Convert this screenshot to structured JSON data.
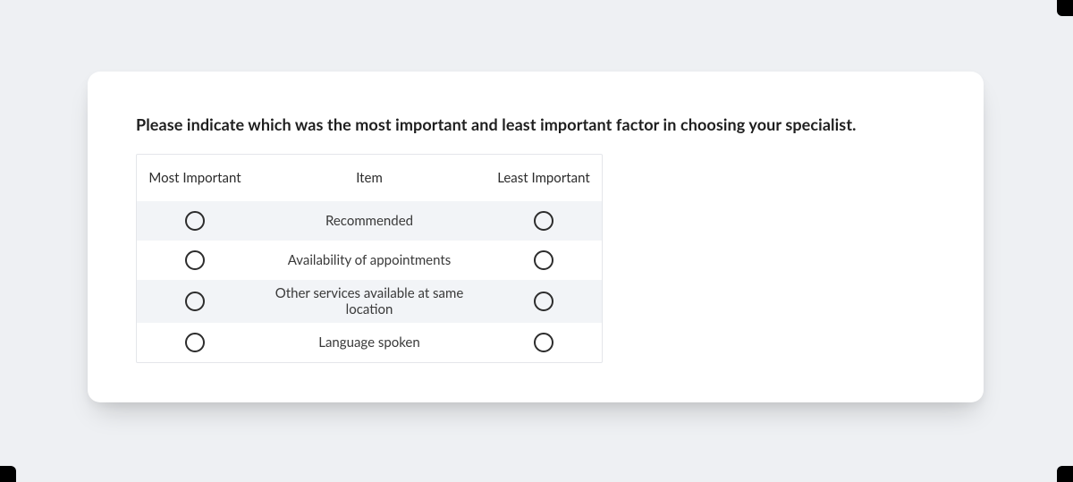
{
  "question": "Please indicate which was the most important and least important factor in choosing your specialist.",
  "columns": {
    "left": "Most Important",
    "mid": "Item",
    "right": "Least Important"
  },
  "items": [
    "Recommended",
    "Availability of appointments",
    "Other services available at same location",
    "Language spoken"
  ]
}
